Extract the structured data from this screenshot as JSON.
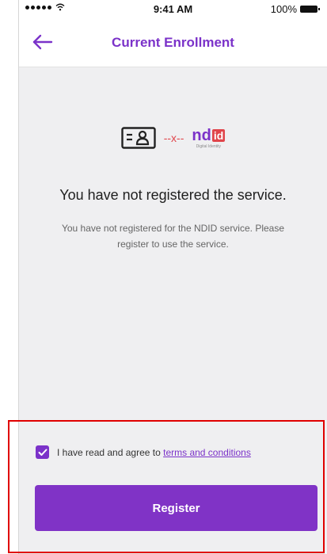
{
  "status_bar": {
    "time": "9:41 AM",
    "battery": "100%"
  },
  "header": {
    "title": "Current Enrollment",
    "back_icon": "arrow-left-icon"
  },
  "illustration": {
    "card_icon": "id-card-icon",
    "disconnect": "--x--",
    "logo_nd": "nd",
    "logo_id": "id",
    "logo_tagline": "Digital Identity"
  },
  "message": {
    "headline": "You have not registered the service.",
    "body": "You have not registered for the NDID service. Please register to use the service."
  },
  "agreement": {
    "checked": true,
    "prefix": "I have read and agree to ",
    "link": "terms and conditions"
  },
  "actions": {
    "register_label": "Register"
  },
  "colors": {
    "accent": "#7b32c9",
    "alert": "#e0454b",
    "highlight": "#e00000"
  }
}
